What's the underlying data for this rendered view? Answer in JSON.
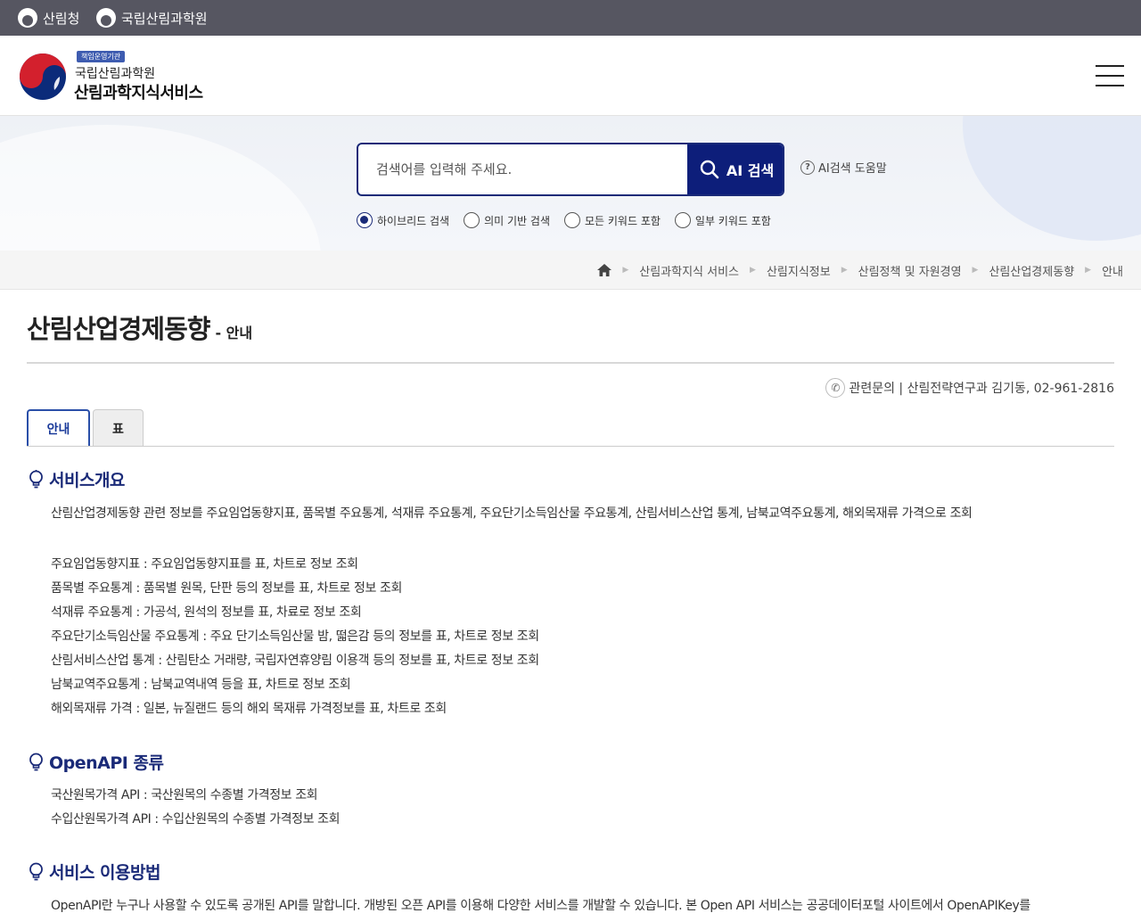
{
  "topbar": {
    "links": [
      {
        "label": "산림청"
      },
      {
        "label": "국립산림과학원"
      }
    ]
  },
  "header": {
    "badge": "책임운영기관",
    "org": "국립산림과학원",
    "service": "산림과학지식서비스"
  },
  "search": {
    "placeholder": "검색어를 입력해 주세요.",
    "button_label": "AI 검색",
    "help_label": "AI검색 도움말",
    "options": [
      "하이브리드 검색",
      "의미 기반 검색",
      "모든 키워드 포함",
      "일부 키워드 포함"
    ],
    "selected": "하이브리드 검색"
  },
  "breadcrumb": [
    "산림과학지식 서비스",
    "산림지식정보",
    "산림정책 및 자원경영",
    "산림산업경제동향",
    "안내"
  ],
  "page": {
    "title": "산림산업경제동향",
    "subtitle": "- 안내",
    "contact": "관련문의 | 산림전략연구과 김기동, 02-961-2816"
  },
  "tabs": [
    {
      "label": "안내",
      "active": true
    },
    {
      "label": "표",
      "active": false
    }
  ],
  "sections": {
    "overview": {
      "title": "서비스개요",
      "intro": "산림산업경제동향 관련 정보를 주요임업동향지표, 품목별 주요통계, 석재류 주요통계, 주요단기소득임산물 주요통계, 산림서비스산업 통계, 남북교역주요통계, 해외목재류 가격으로 조회",
      "items": [
        "주요임업동향지표 : 주요임업동향지표를 표, 차트로 정보 조회",
        "품목별 주요통계 : 품목별 원목, 단판 등의 정보를 표, 차트로 정보 조회",
        "석재류 주요통계 : 가공석, 원석의 정보를 표, 차료로 정보 조회",
        "주요단기소득임산물 주요통계 : 주요 단기소득임산물 밤, 떫은감 등의 정보를 표, 차트로 정보 조회",
        "산림서비스산업 통계 : 산림탄소 거래량, 국립자연휴양림 이용객 등의 정보를 표, 차트로 정보 조회",
        "남북교역주요통계 : 남북교역내역 등을 표, 차트로 정보 조회",
        "해외목재류 가격 : 일본, 뉴질랜드 등의 해외 목재류 가격정보를 표, 차트로 조회"
      ]
    },
    "openapi": {
      "title": "OpenAPI 종류",
      "items": [
        "국산원목가격 API : 국산원목의 수종별 가격정보 조회",
        "수입산원목가격 API : 수입산원목의 수종별 가격정보 조회"
      ]
    },
    "usage": {
      "title": "서비스 이용방법",
      "text": "OpenAPI란 누구나 사용할 수 있도록 공개된 API를 말합니다. 개방된 오픈 API를 이용해 다양한 서비스를 개발할 수 있습니다. 본 Open API 서비스는 공공데이터포털 사이트에서 OpenAPIKey를"
    }
  },
  "colors": {
    "topbar": "#565661",
    "accent": "#1a2a78",
    "search_button": "#0d1e7a",
    "section_title": "#1a2a78"
  }
}
